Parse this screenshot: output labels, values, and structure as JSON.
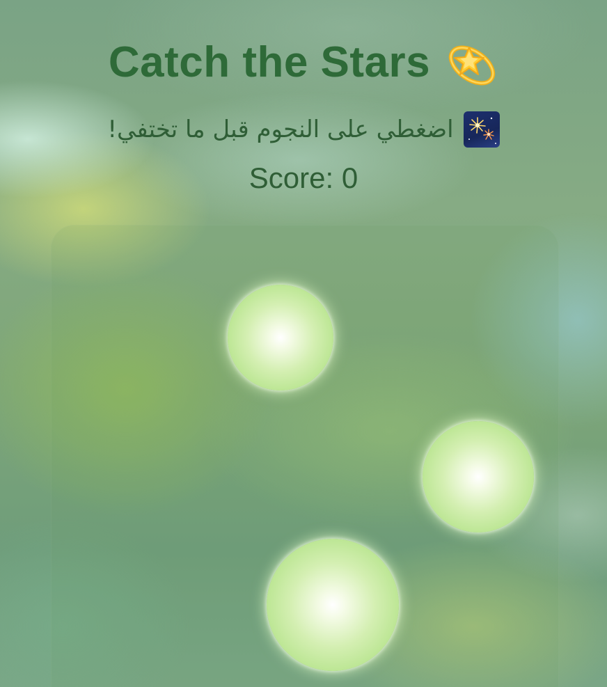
{
  "header": {
    "title": "Catch the Stars",
    "title_icon": "dizzy-star-icon",
    "subtitle": "اضغطي على النجوم قبل ما تختفي!",
    "subtitle_icon": "fireworks-icon",
    "score_text": "Score: 0"
  },
  "game": {
    "score": 0,
    "stars_visible": 3
  },
  "colors": {
    "title": "#2e6a38",
    "text": "#2f5e36",
    "star_core": "#ffffff",
    "star_edge": "#a9dd7e"
  }
}
